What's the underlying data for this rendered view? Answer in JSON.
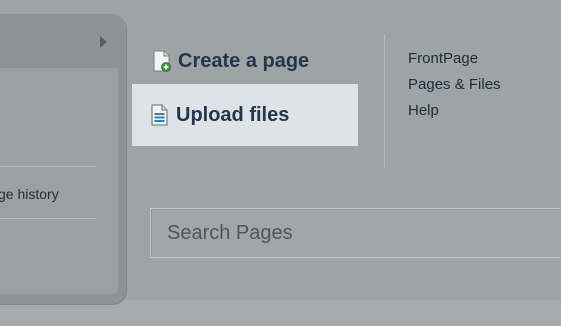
{
  "sidebar": {
    "history_label": "ge history"
  },
  "actions": {
    "create_label": "Create a page",
    "upload_label": "Upload files"
  },
  "nav": {
    "items": [
      {
        "label": "FrontPage"
      },
      {
        "label": "Pages & Files"
      },
      {
        "label": "Help"
      }
    ]
  },
  "search": {
    "placeholder": "Search Pages"
  },
  "icons": {
    "create": "new-page-icon",
    "upload": "upload-file-icon",
    "expand": "triangle-right-icon"
  },
  "colors": {
    "background": "#9ea3a6",
    "panel": "#8c9499",
    "highlight": "#dde3e7",
    "action_text": "#23364a",
    "link_text": "#1e2b38"
  }
}
